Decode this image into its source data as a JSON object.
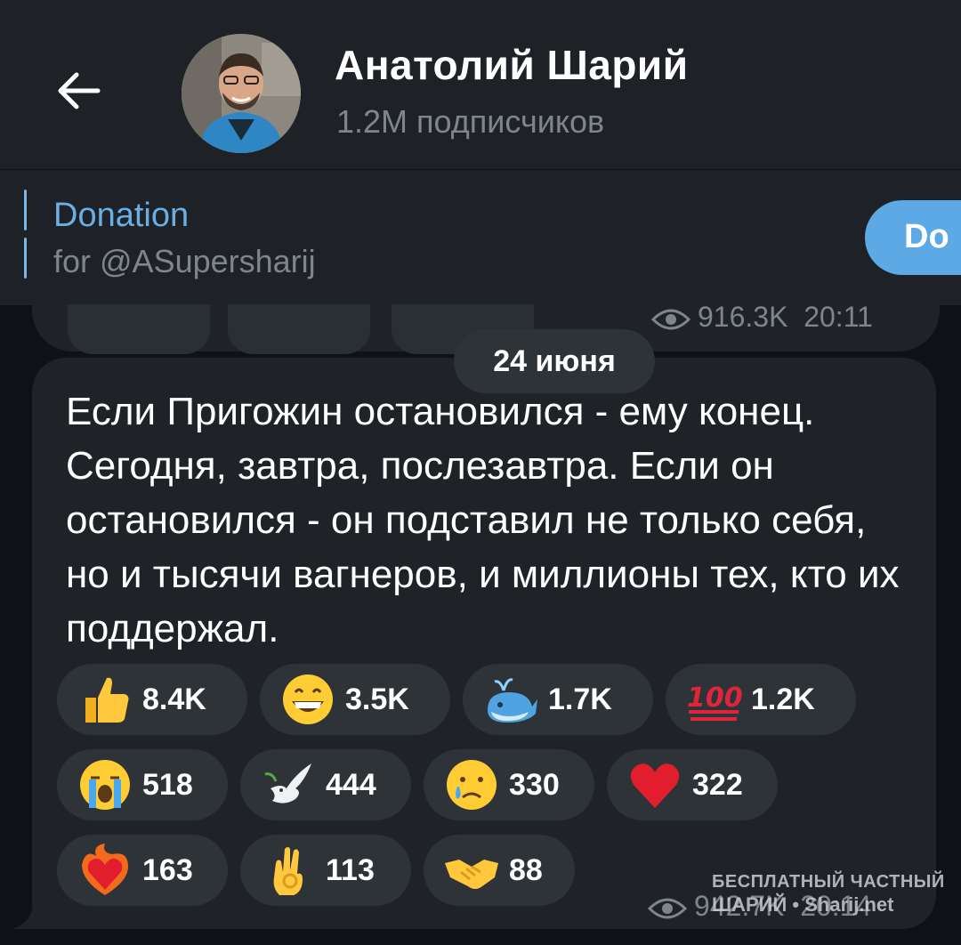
{
  "header": {
    "channel_name": "Анатолий Шарий",
    "subscribers": "1.2M подписчиков",
    "back_icon": "arrow-left-icon",
    "avatar_icon": "avatar"
  },
  "pinned": {
    "title": "Donation",
    "subtitle": "for @ASupersharij",
    "button_label": "Do"
  },
  "previous_message": {
    "views": "916.3K",
    "time": "20:11"
  },
  "date_chip": "24 июня",
  "message": {
    "text": "Если Пригожин остановился - ему конец. Сегодня, завтра, послезавтра. Если он остановился - он подставил не только себя, но и тысячи вагнеров, и миллионы тех, кто их поддержал.",
    "reactions": [
      {
        "emoji": "thumbs-up-icon",
        "count": "8.4K"
      },
      {
        "emoji": "grinning-face-icon",
        "count": "3.5K"
      },
      {
        "emoji": "whale-icon",
        "count": "1.7K"
      },
      {
        "emoji": "hundred-points-icon",
        "count": "1.2K"
      },
      {
        "emoji": "loudly-crying-face-icon",
        "count": "518"
      },
      {
        "emoji": "dove-icon",
        "count": "444"
      },
      {
        "emoji": "crying-face-icon",
        "count": "330"
      },
      {
        "emoji": "red-heart-icon",
        "count": "322"
      },
      {
        "emoji": "heart-on-fire-icon",
        "count": "163"
      },
      {
        "emoji": "ok-hand-icon",
        "count": "113"
      },
      {
        "emoji": "handshake-icon",
        "count": "88"
      }
    ],
    "views": "942.7K",
    "time": "20:14"
  },
  "watermark": {
    "line1": "БЕСПЛАТНЫЙ ЧАСТНЫЙ",
    "line2": "ШАРИЙ • Sharij.net"
  },
  "colors": {
    "background": "#0e1116",
    "header": "#1e2226",
    "bubble": "#1f2327",
    "reaction_pill": "#2e3338",
    "accent_blue": "#5ca9e6",
    "muted_text": "#7f858c"
  }
}
